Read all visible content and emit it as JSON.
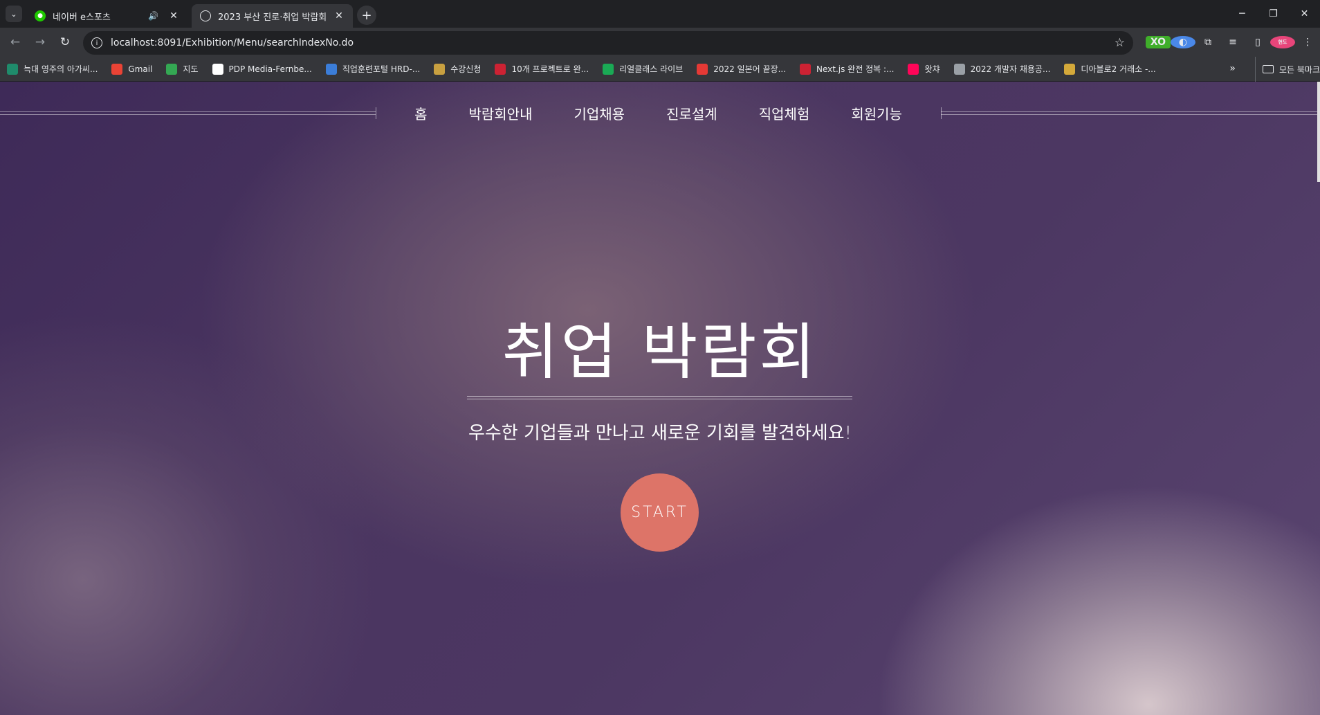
{
  "browser": {
    "tabs": [
      {
        "title": "네이버 e스포츠",
        "favicon": "naver-esports-icon"
      },
      {
        "title": "2023 부산 진로·취업 박람회",
        "favicon": "globe-icon"
      }
    ],
    "url": "localhost:8091/Exhibition/Menu/searchIndexNo.do",
    "profile_initials": "현도"
  },
  "bookmarks": [
    {
      "label": "늑대 영주의 아가씨...",
      "icon": "book-icon",
      "color": "#1f8b6b"
    },
    {
      "label": "Gmail",
      "icon": "gmail-icon",
      "color": "#ea4335"
    },
    {
      "label": "지도",
      "icon": "maps-icon",
      "color": "#34a853"
    },
    {
      "label": "PDP Media-Fernbe...",
      "icon": "amazon-icon",
      "color": "#ffffff"
    },
    {
      "label": "직업훈련포털 HRD-...",
      "icon": "hrd-icon",
      "color": "#3b7dd8"
    },
    {
      "label": "수강신청",
      "icon": "course-icon",
      "color": "#c8a040"
    },
    {
      "label": "10개 프로젝트로 완...",
      "icon": "ruby-icon",
      "color": "#cc2233"
    },
    {
      "label": "리얼클래스 라이브",
      "icon": "realclass-icon",
      "color": "#1aaa55"
    },
    {
      "label": "2022 일본어 끝장...",
      "icon": "s-icon",
      "color": "#e53935"
    },
    {
      "label": "Next.js 완전 정복 :...",
      "icon": "ruby-icon",
      "color": "#cc2233"
    },
    {
      "label": "왓챠",
      "icon": "watcha-icon",
      "color": "#ff0558"
    },
    {
      "label": "2022 개발자 채용공...",
      "icon": "globe-icon",
      "color": "#9aa0a6"
    },
    {
      "label": "디아블로2 거래소 -...",
      "icon": "diablo-icon",
      "color": "#d4a93a"
    }
  ],
  "bookmarks_all_label": "모든 북마크",
  "site": {
    "nav": [
      "홈",
      "박람회안내",
      "기업채용",
      "진로설계",
      "직업체험",
      "회원기능"
    ],
    "hero_title": "취업 박람회",
    "hero_subtitle": "우수한 기업들과 만나고 새로운 기회를 발견하세요!",
    "start_label": "START",
    "start_color": "#dd7468"
  }
}
